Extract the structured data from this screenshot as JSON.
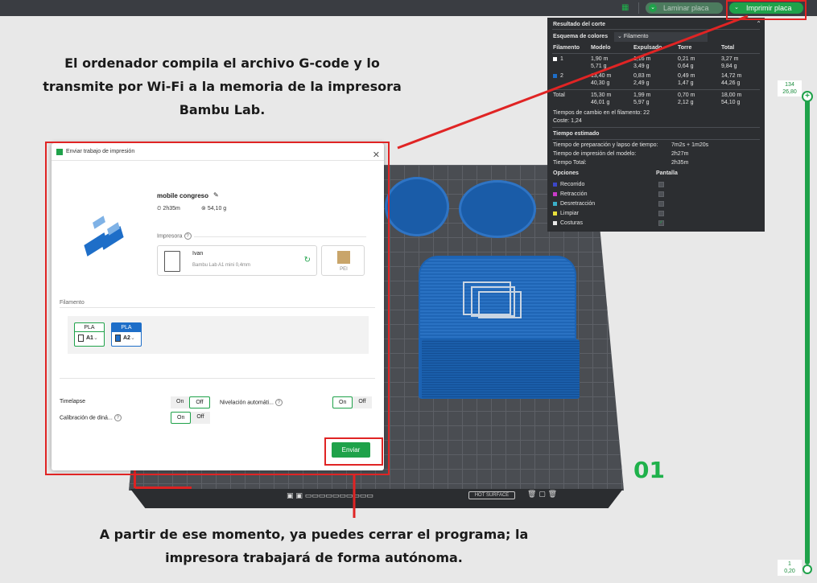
{
  "toolbar": {
    "laminar_label": "Laminar placa",
    "imprimir_label": "Imprimir placa"
  },
  "annotations": {
    "top": [
      "El ordenador compila el archivo G-code y lo",
      "transmite por Wi-Fi a la memoria de la impresora",
      "Bambu Lab."
    ],
    "bottom": [
      "A partir de ese momento, ya puedes cerrar el programa; la",
      "impresora trabajará de forma autónoma."
    ]
  },
  "slice_panel": {
    "title": "Resultado del corte",
    "color_scheme_label": "Esquema de colores",
    "color_scheme_value": "Filamento",
    "headers": [
      "Filamento",
      "Modelo",
      "Expulsado",
      "Torre",
      "Total"
    ],
    "rows": [
      {
        "id": "1",
        "swatch": "#ffffff",
        "modelo": [
          "1,90 m",
          "5,71 g"
        ],
        "expulsado": [
          "1,16 m",
          "3,49 g"
        ],
        "torre": [
          "0,21 m",
          "0,64 g"
        ],
        "total": [
          "3,27 m",
          "9,84 g"
        ]
      },
      {
        "id": "2",
        "swatch": "#1e6ec8",
        "modelo": [
          "13,40 m",
          "40,30 g"
        ],
        "expulsado": [
          "0,83 m",
          "2,49 g"
        ],
        "torre": [
          "0,49 m",
          "1,47 g"
        ],
        "total": [
          "14,72 m",
          "44,26 g"
        ]
      },
      {
        "id": "Total",
        "swatch": "",
        "modelo": [
          "15,30 m",
          "46,01 g"
        ],
        "expulsado": [
          "1,99 m",
          "5,97 g"
        ],
        "torre": [
          "0,70 m",
          "2,12 g"
        ],
        "total": [
          "18,00 m",
          "54,10 g"
        ]
      }
    ],
    "changes_text": "Tiempos de cambio en el filamento:  22",
    "cost_text": "Coste:  1,24",
    "time_title": "Tiempo estimado",
    "time_rows": [
      {
        "label": "Tiempo de preparación y lapso de tiempo:",
        "value": "7m2s + 1m20s"
      },
      {
        "label": "Tiempo de impresión del modelo:",
        "value": "2h27m"
      },
      {
        "label": "Tiempo Total:",
        "value": "2h35m"
      }
    ],
    "options_title": "Opciones",
    "display_title": "Pantalla",
    "options": [
      {
        "label": "Recorrido",
        "color": "#3b47c9"
      },
      {
        "label": "Retracción",
        "color": "#c93bc9"
      },
      {
        "label": "Desretracción",
        "color": "#3bb0c9"
      },
      {
        "label": "Limpiar",
        "color": "#e8e03b"
      },
      {
        "label": "Costuras",
        "color": "#e8e8e8"
      }
    ]
  },
  "slider": {
    "top_layer": "134",
    "top_height": "26,80",
    "bottom_layer": "1",
    "bottom_height": "0,20"
  },
  "plate": {
    "number": "01",
    "surface_label": "HOT SURFACE"
  },
  "dialog": {
    "title": "Enviar trabajo de impresión",
    "project_name": "mobile congreso",
    "time": "2h35m",
    "weight": "54,10 g",
    "printer_section": "Impresora",
    "printer_name": "Ivan",
    "printer_model": "Bambu Lab A1 mini 0,4mm",
    "plate_type": "PEI",
    "filament_section": "Filamento",
    "filaments": [
      {
        "type": "PLA",
        "slot": "A1",
        "color": "#ffffff"
      },
      {
        "type": "PLA",
        "slot": "A2",
        "color": "#1e6ec8"
      }
    ],
    "timelapse_label": "Timelapse",
    "leveling_label": "Nivelación automáti...",
    "calib_label": "Calibración de diná...",
    "on_label": "On",
    "off_label": "Off",
    "send_label": "Enviar"
  }
}
